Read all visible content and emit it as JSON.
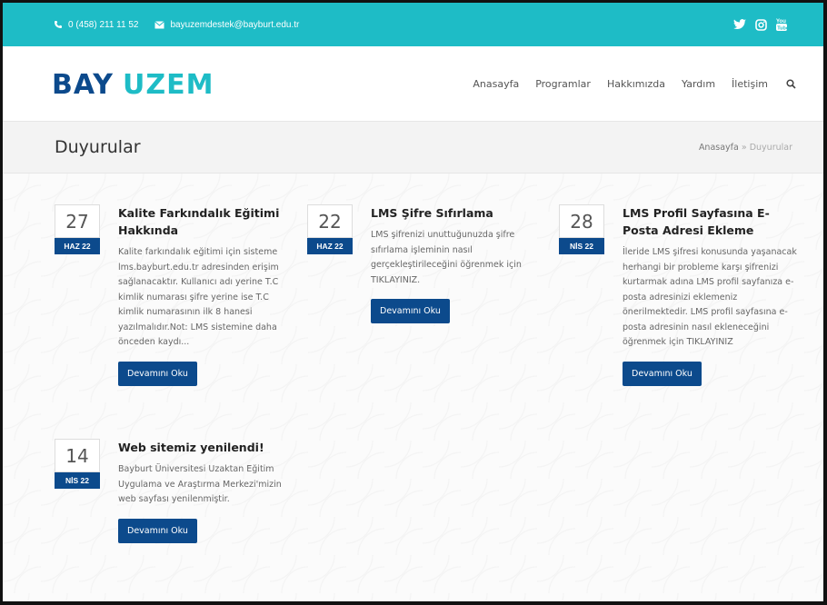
{
  "topbar": {
    "phone": "0 (458) 211 11 52",
    "email": "bayuzemdestek@bayburt.edu.tr",
    "social": [
      "twitter-icon",
      "instagram-icon",
      "youtube-icon"
    ]
  },
  "logo": {
    "text": "BAYUZEM"
  },
  "nav": {
    "items": [
      "Anasayfa",
      "Programlar",
      "Hakkımızda",
      "Yardım",
      "İletişim"
    ]
  },
  "page": {
    "title": "Duyurular",
    "breadcrumb": {
      "home": "Anasayfa",
      "separator": "»",
      "current": "Duyurular"
    }
  },
  "posts": [
    {
      "day": "27",
      "month": "HAZ 22",
      "title": "Kalite Farkındalık Eğitimi Hakkında",
      "excerpt": "Kalite farkındalık eğitimi için sisteme lms.bayburt.edu.tr adresinden erişim sağlanacaktır. Kullanıcı adı yerine T.C kimlik numarası şifre yerine ise T.C kimlik numarasının ilk 8 hanesi yazılmalıdır.Not: LMS sistemine daha önceden kaydı...",
      "button": "Devamını Oku"
    },
    {
      "day": "22",
      "month": "HAZ 22",
      "title": "LMS Şifre Sıfırlama",
      "excerpt": "LMS şifrenizi unuttuğunuzda şifre sıfırlama işleminin nasıl gerçekleştirileceğini öğrenmek için TIKLAYINIZ.",
      "button": "Devamını Oku"
    },
    {
      "day": "28",
      "month": "NİS 22",
      "title": "LMS Profil Sayfasına E-Posta Adresi Ekleme",
      "excerpt": "İleride LMS şifresi konusunda yaşanacak herhangi bir probleme karşı şifrenizi kurtarmak adına LMS profil sayfanıza e-posta adresinizi eklemeniz önerilmektedir. LMS profil sayfasına e-posta adresinin nasıl ekleneceğini öğrenmek için TIKLAYINIZ",
      "button": "Devamını Oku"
    },
    {
      "day": "14",
      "month": "NİS 22",
      "title": "Web sitemiz yenilendi!",
      "excerpt": "Bayburt Üniversitesi Uzaktan Eğitim Uygulama ve Araştırma Merkezi'mizin web sayfası yenilenmiştir.",
      "button": "Devamını Oku"
    }
  ],
  "colors": {
    "accent": "#1ebcc6",
    "primary": "#0c4a8c"
  }
}
